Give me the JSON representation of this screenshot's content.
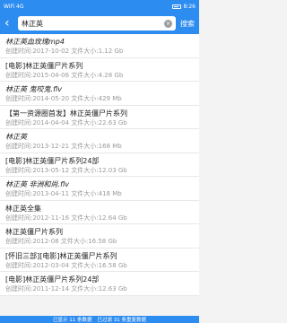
{
  "status": {
    "left": "WiFi 4G",
    "right": "8:26"
  },
  "search": {
    "value": "林正英",
    "button": "搜索",
    "back": "‹",
    "clear": "×"
  },
  "results": [
    {
      "title": "林正英血玫瑰mp4",
      "meta": "创建时间:2017-10-02 文件大小:1.12 Gb",
      "hl": true
    },
    {
      "title": "[电影]林正英僵尸片系列",
      "meta": "创建时间:2015-04-06 文件大小:4.28 Gb",
      "hl": false
    },
    {
      "title": "林正英 鬼咬鬼.flv",
      "meta": "创建时间:2014-05-20 文件大小:429 Mb",
      "hl": true
    },
    {
      "title": "【第一资源圈首发】林正英僵尸片系列",
      "meta": "创建时间:2014-04-04 文件大小:22.63 Gb",
      "hl": false
    },
    {
      "title": "林正英",
      "meta": "创建时间:2013-12-21 文件大小:168 Mb",
      "hl": true
    },
    {
      "title": "[电影]林正英僵尸片系列24部",
      "meta": "创建时间:2013-05-12 文件大小:12.03 Gb",
      "hl": false
    },
    {
      "title": "林正英 非洲和尚.flv",
      "meta": "创建时间:2013-04-11 文件大小:418 Mb",
      "hl": true
    },
    {
      "title": "林正英全集",
      "meta": "创建时间:2012-11-16 文件大小:12.64 Gb",
      "hl": false
    },
    {
      "title": "林正英僵尸片系列",
      "meta": "创建时间:2012-08 文件大小:16.58 Gb",
      "hl": false
    },
    {
      "title": "[怀旧三部][电影]林正英僵尸片系列",
      "meta": "创建时间:2012-03-04 文件大小:16.58 Gb",
      "hl": false
    },
    {
      "title": "[电影]林正英僵尸片系列24部",
      "meta": "创建时间:2011-12-14 文件大小:12.63 Gb",
      "hl": false
    }
  ],
  "footer": {
    "left": "已显示 11 条数据",
    "right": "已过滤 31 条重复数据"
  }
}
